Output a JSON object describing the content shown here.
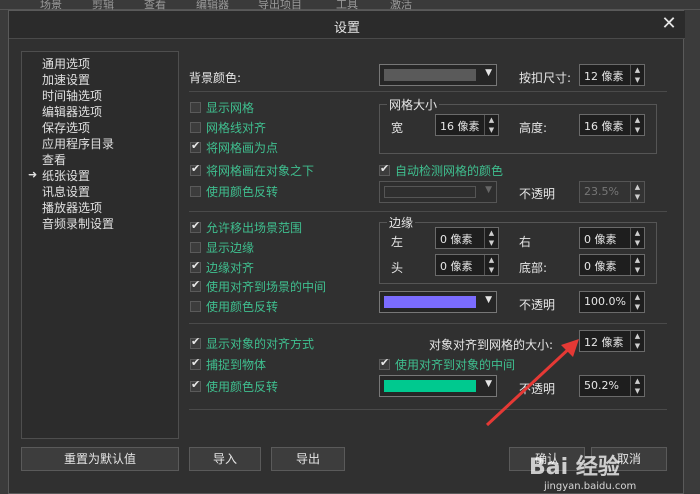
{
  "app": {
    "menu": [
      "场景",
      "剪辑",
      "查看",
      "编辑器",
      "导出项目",
      "工具",
      "激活"
    ]
  },
  "dialog": {
    "title": "设置",
    "close": "✕"
  },
  "nav": {
    "items": [
      "通用选项",
      "加速设置",
      "时间轴选项",
      "编辑器选项",
      "保存选项",
      "应用程序目录",
      "查看",
      "纸张设置",
      "讯息设置",
      "播放器选项",
      "音频录制设置"
    ],
    "selected_marker": "➜"
  },
  "background": {
    "label": "背景颜色:",
    "color": "#5a5a5a",
    "button_size_label": "按扣尺寸:",
    "button_size_value": "12 像素"
  },
  "grid": {
    "show": {
      "label": "显示网格",
      "checked": false
    },
    "snap": {
      "label": "网格线对齐",
      "checked": false
    },
    "dots": {
      "label": "将网格画为点",
      "checked": true
    },
    "below": {
      "label": "将网格画在对象之下",
      "checked": true
    },
    "invert": {
      "label": "使用颜色反转",
      "checked": false
    },
    "size_title": "网格大小",
    "width_label": "宽",
    "width_value": "16 像素",
    "height_label": "高度:",
    "height_value": "16 像素",
    "auto_detect": {
      "label": "自动检测网格的颜色",
      "checked": true
    },
    "color": "#2f2f2f",
    "opacity_label": "不透明",
    "opacity_value": "23.5%"
  },
  "margin": {
    "allow_out": {
      "label": "允许移出场景范围",
      "checked": true
    },
    "show_edge": {
      "label": "显示边缘",
      "checked": false
    },
    "edge_snap": {
      "label": "边缘对齐",
      "checked": true
    },
    "center_snap": {
      "label": "使用对齐到场景的中间",
      "checked": true
    },
    "invert": {
      "label": "使用颜色反转",
      "checked": false
    },
    "title": "边缘",
    "left_label": "左",
    "left_value": "0 像素",
    "right_label": "右",
    "right_value": "0 像素",
    "top_label": "头",
    "top_value": "0 像素",
    "bottom_label": "底部:",
    "bottom_value": "0 像素",
    "color": "#7b6cff",
    "opacity_label": "不透明",
    "opacity_value": "100.0%"
  },
  "objects": {
    "show_align": {
      "label": "显示对象的对齐方式",
      "checked": true
    },
    "snap_objects": {
      "label": "捕捉到物体",
      "checked": true
    },
    "invert": {
      "label": "使用颜色反转",
      "checked": true
    },
    "snap_size_label": "对象对齐到网格的大小:",
    "snap_size_value": "12 像素",
    "center_snap": {
      "label": "使用对齐到对象的中间",
      "checked": true
    },
    "color": "#00c98f",
    "opacity_label": "不透明",
    "opacity_value": "50.2%"
  },
  "footer": {
    "reset": "重置为默认值",
    "import": "导入",
    "export": "导出",
    "ok": "确认",
    "cancel": "取消"
  },
  "watermark": {
    "text": "Bai 经验",
    "sub": "jingyan.baidu.com"
  },
  "colors": {
    "accent_green": "#3fbf8f",
    "arrow_red": "#e53935"
  }
}
